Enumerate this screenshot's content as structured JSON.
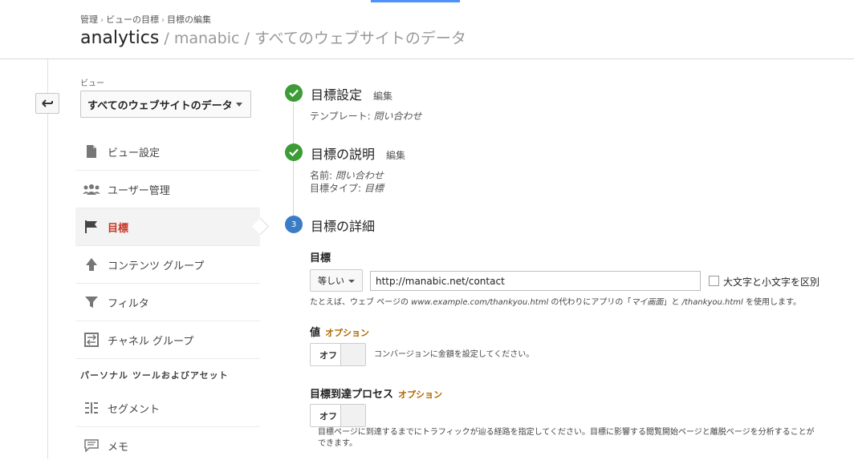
{
  "breadcrumb": [
    "管理",
    "ビューの目標",
    "目標の編集"
  ],
  "header": {
    "product": "analytics",
    "account": "manabic",
    "view": "すべてのウェブサイトのデータ",
    "separator": " / "
  },
  "sidebar": {
    "view_label": "ビュー",
    "view_selected": "すべてのウェブサイトのデータ",
    "items": [
      {
        "label": "ビュー設定",
        "icon": "document-icon"
      },
      {
        "label": "ユーザー管理",
        "icon": "people-icon"
      },
      {
        "label": "目標",
        "icon": "flag-icon",
        "active": true
      },
      {
        "label": "コンテンツ グループ",
        "icon": "content-group-icon"
      },
      {
        "label": "フィルタ",
        "icon": "filter-icon"
      },
      {
        "label": "チャネル グループ",
        "icon": "channel-group-icon"
      }
    ],
    "personal_heading": "パーソナル ツールおよびアセット",
    "personal_items": [
      {
        "label": "セグメント",
        "icon": "segment-icon"
      },
      {
        "label": "メモ",
        "icon": "memo-icon"
      }
    ]
  },
  "steps": [
    {
      "num": "✓",
      "title": "目標設定",
      "edit": "編集",
      "details": [
        {
          "key": "テンプレート:",
          "value": "問い合わせ"
        }
      ]
    },
    {
      "num": "✓",
      "title": "目標の説明",
      "edit": "編集",
      "details": [
        {
          "key": "名前:",
          "value": "問い合わせ"
        },
        {
          "key": "目標タイプ:",
          "value": "目標"
        }
      ]
    },
    {
      "num": "3",
      "title": "目標の詳細"
    }
  ],
  "destination": {
    "label": "目標",
    "match_type": "等しい",
    "url_value": "http://manabic.net/contact",
    "case_sensitive_label": "大文字と小文字を区別",
    "hint_prefix": "たとえば、ウェブ ページの",
    "hint_example": "www.example.com/thankyou.html",
    "hint_mid": "の代わりにアプリの「",
    "hint_app": "マイ画面",
    "hint_mid2": "」と",
    "hint_path": "/thankyou.html",
    "hint_suffix": "を使用します。"
  },
  "value": {
    "label": "値",
    "optional": "オプション",
    "toggle": "オフ",
    "desc": "コンバージョンに金額を設定してください。"
  },
  "funnel": {
    "label": "目標到達プロセス",
    "optional": "オプション",
    "toggle": "オフ",
    "desc_line1": "目標ページに到達するまでにトラフィックが辿る経路を指定してください。目標に影響する閲覧開始ページと離脱ページを分析することが",
    "desc_line2": "できます。"
  },
  "colors": {
    "accent_blue": "#4d90fe",
    "done_green": "#3d9c36",
    "current_blue": "#3b7dc4",
    "active_red": "#c53727",
    "optional_orange": "#b06900"
  }
}
